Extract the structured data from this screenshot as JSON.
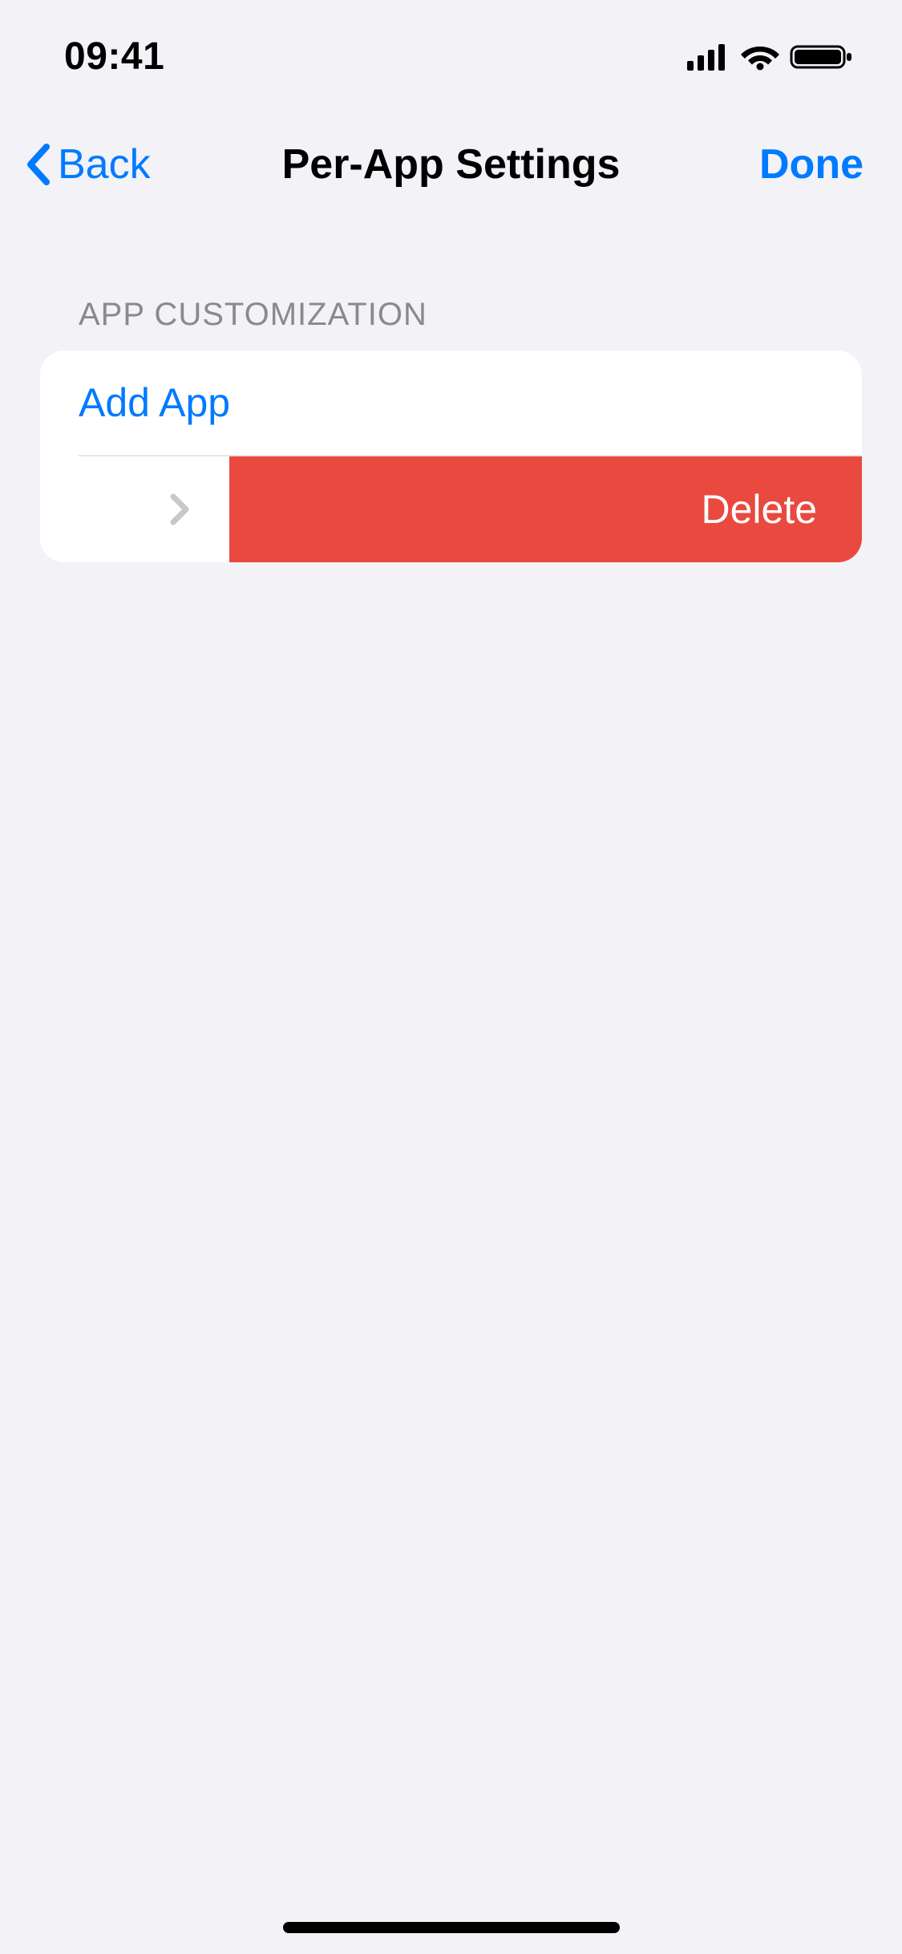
{
  "status": {
    "time": "09:41"
  },
  "nav": {
    "back_label": "Back",
    "title": "Per-App Settings",
    "done_label": "Done"
  },
  "section": {
    "header": "APP CUSTOMIZATION",
    "add_label": "Add App",
    "delete_label": "Delete"
  },
  "colors": {
    "accent": "#007aff",
    "destructive": "#e9493e",
    "background": "#f2f2f7"
  }
}
